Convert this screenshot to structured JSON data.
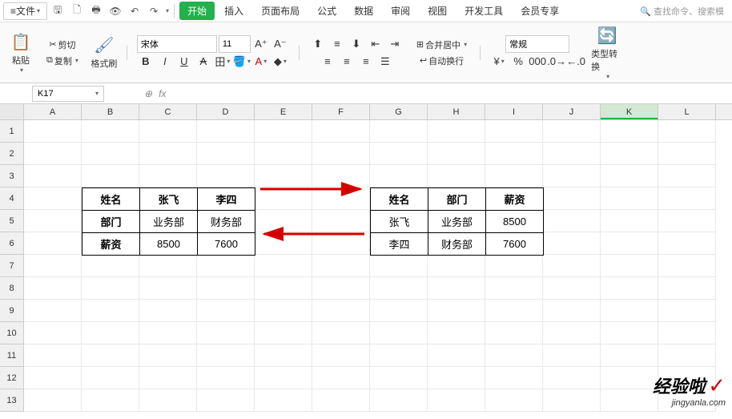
{
  "menu": {
    "file": "文件",
    "tabs": [
      "开始",
      "插入",
      "页面布局",
      "公式",
      "数据",
      "审阅",
      "视图",
      "开发工具",
      "会员专享"
    ],
    "search_placeholder": "查找命令、搜索模"
  },
  "ribbon": {
    "paste": "粘贴",
    "cut": "剪切",
    "copy": "复制",
    "format_painter": "格式刷",
    "font_name": "宋体",
    "font_size": "11",
    "merge": "合并居中",
    "wrap": "自动换行",
    "num_format": "常规",
    "convert": "类型转换"
  },
  "formula_bar": {
    "cell_ref": "K17",
    "fx": "fx",
    "value": ""
  },
  "columns": [
    "A",
    "B",
    "C",
    "D",
    "E",
    "F",
    "G",
    "H",
    "I",
    "J",
    "K",
    "L"
  ],
  "rows": [
    "1",
    "2",
    "3",
    "4",
    "5",
    "6",
    "7",
    "8",
    "9",
    "10",
    "11",
    "12",
    "13"
  ],
  "table_left": {
    "r1": [
      "姓名",
      "张飞",
      "李四"
    ],
    "r2": [
      "部门",
      "业务部",
      "财务部"
    ],
    "r3": [
      "薪资",
      "8500",
      "7600"
    ]
  },
  "table_right": {
    "r1": [
      "姓名",
      "部门",
      "薪资"
    ],
    "r2": [
      "张飞",
      "业务部",
      "8500"
    ],
    "r3": [
      "李四",
      "财务部",
      "7600"
    ]
  },
  "watermark": {
    "main": "经验啦",
    "sub": "jingyanla.com"
  },
  "selected_col": "K"
}
